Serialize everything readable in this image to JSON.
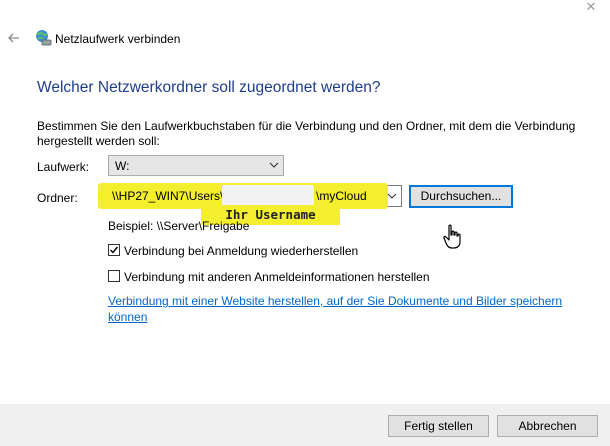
{
  "window": {
    "close_glyph": "✕",
    "title": "Netzlaufwerk verbinden"
  },
  "heading": "Welcher Netzwerkordner soll zugeordnet werden?",
  "instructions": "Bestimmen Sie den Laufwerkbuchstaben für die Verbindung und den Ordner, mit dem die Verbindung hergestellt werden soll:",
  "drive": {
    "label": "Laufwerk:",
    "value": "W:"
  },
  "folder": {
    "label": "Ordner:",
    "value_prefix": "\\\\HP27_WIN7\\Users\\",
    "value_suffix": "\\myCloud",
    "browse_label": "Durchsuchen..."
  },
  "annotation": {
    "username_label": "Ihr Username",
    "highlight_color": "#f3ef2f"
  },
  "example": "Beispiel: \\\\Server\\Freigabe",
  "options": {
    "reconnect": {
      "label": "Verbindung bei Anmeldung wiederherstellen",
      "checked": true
    },
    "other_credentials": {
      "label": "Verbindung mit anderen Anmeldeinformationen herstellen",
      "checked": false
    }
  },
  "link": "Verbindung mit einer Website herstellen, auf der Sie Dokumente und Bilder speichern können",
  "footer": {
    "finish_label": "Fertig stellen",
    "cancel_label": "Abbrechen"
  },
  "icons": {
    "back": "back-arrow-icon",
    "window": "network-drive-icon",
    "chevron": "chevron-down-icon",
    "cursor": "hand-cursor-icon"
  },
  "colors": {
    "heading": "#1e3d8c",
    "link": "#0066cc",
    "focus_border": "#0078d7",
    "footer_bg": "#f0f0f0"
  }
}
